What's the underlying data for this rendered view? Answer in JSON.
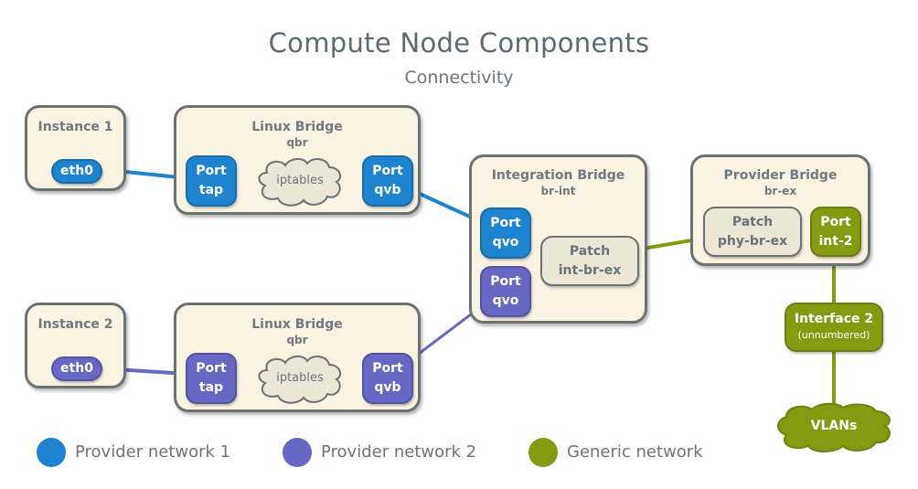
{
  "header": {
    "title": "Compute Node Components",
    "subtitle": "Connectivity"
  },
  "colors": {
    "provider_network_1": "#1e84d0",
    "provider_network_2": "#6767c4",
    "generic_network": "#849a10",
    "box_fill": "#fbf3e2",
    "patch_fill": "#ece6d6",
    "border": "#6b7274"
  },
  "instance1": {
    "title": "Instance 1",
    "port": "eth0"
  },
  "instance2": {
    "title": "Instance 2",
    "port": "eth0"
  },
  "linux_bridge1": {
    "title": "Linux Bridge",
    "subtitle": "qbr",
    "port_tap": {
      "line1": "Port",
      "line2": "tap"
    },
    "firewall": "iptables",
    "port_qvb": {
      "line1": "Port",
      "line2": "qvb"
    }
  },
  "linux_bridge2": {
    "title": "Linux Bridge",
    "subtitle": "qbr",
    "port_tap": {
      "line1": "Port",
      "line2": "tap"
    },
    "firewall": "iptables",
    "port_qvb": {
      "line1": "Port",
      "line2": "qvb"
    }
  },
  "integration_bridge": {
    "title": "Integration Bridge",
    "subtitle": "br-int",
    "port_qvo1": {
      "line1": "Port",
      "line2": "qvo"
    },
    "port_qvo2": {
      "line1": "Port",
      "line2": "qvo"
    },
    "patch": {
      "line1": "Patch",
      "line2": "int-br-ex"
    }
  },
  "provider_bridge": {
    "title": "Provider Bridge",
    "subtitle": "br-ex",
    "patch": {
      "line1": "Patch",
      "line2": "phy-br-ex"
    },
    "port": {
      "line1": "Port",
      "line2": "int-2"
    }
  },
  "interface2": {
    "title": "Interface 2",
    "subtitle": "(unnumbered)"
  },
  "vlans": {
    "label": "VLANs"
  },
  "legend": [
    {
      "label": "Provider network 1",
      "color": "#1e84d0"
    },
    {
      "label": "Provider network 2",
      "color": "#6767c4"
    },
    {
      "label": "Generic network",
      "color": "#849a10"
    }
  ]
}
